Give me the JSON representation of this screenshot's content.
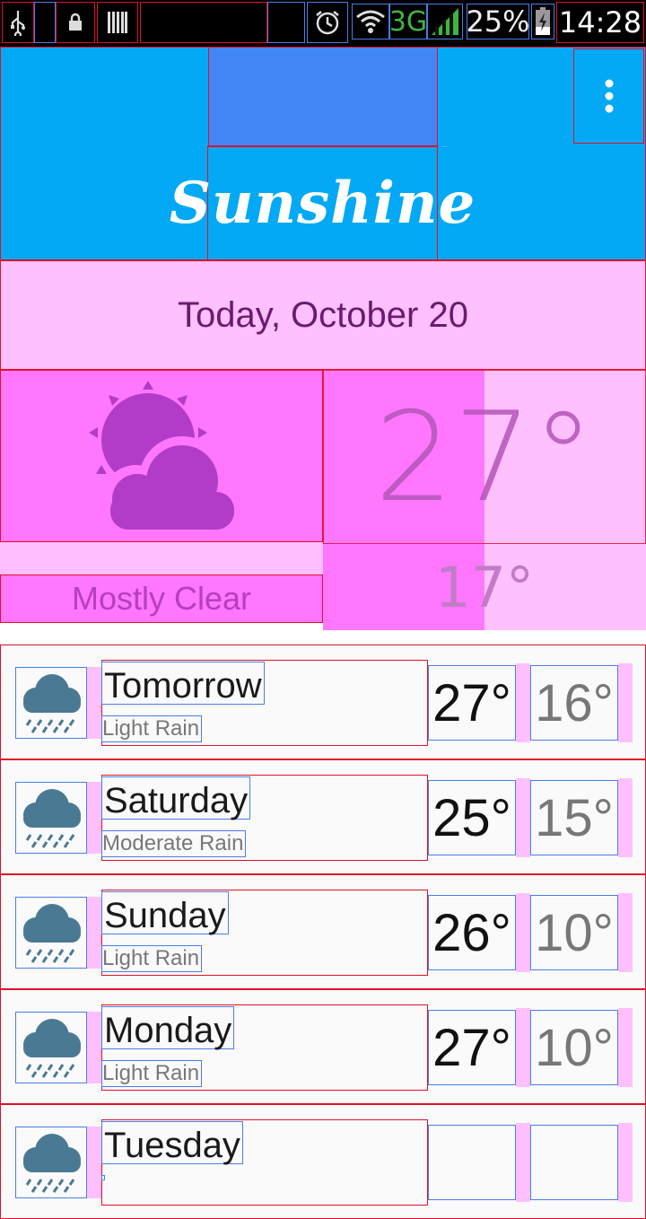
{
  "status_bar": {
    "network": "3G",
    "battery": "25%",
    "time": "14:28",
    "icons": [
      "usb-icon",
      "lock-icon",
      "barcode-icon",
      "alarm-icon",
      "wifi-icon",
      "signal-icon",
      "battery-icon"
    ]
  },
  "app": {
    "title": "Sunshine",
    "menu_icon": "overflow-menu-icon"
  },
  "today": {
    "date": "Today, October 20",
    "condition": "Mostly Clear",
    "high": "27°",
    "low": "17°",
    "icon": "partly-cloudy-icon"
  },
  "forecast": [
    {
      "day": "Tomorrow",
      "condition": "Light Rain",
      "high": "27°",
      "low": "16°",
      "icon": "rain-cloud-icon"
    },
    {
      "day": "Saturday",
      "condition": "Moderate Rain",
      "high": "25°",
      "low": "15°",
      "icon": "rain-cloud-icon"
    },
    {
      "day": "Sunday",
      "condition": "Light Rain",
      "high": "26°",
      "low": "10°",
      "icon": "rain-cloud-icon"
    },
    {
      "day": "Monday",
      "condition": "Light Rain",
      "high": "27°",
      "low": "10°",
      "icon": "rain-cloud-icon"
    },
    {
      "day": "Tuesday",
      "condition": "",
      "high": "",
      "low": "",
      "icon": "rain-cloud-icon"
    }
  ],
  "colors": {
    "header": "#03a9f4",
    "title_block": "#4285f4",
    "highlight_pink": "#ffc0ff",
    "highlight_magenta": "#ff77ff",
    "icon_cloud": "#4a7a93"
  }
}
